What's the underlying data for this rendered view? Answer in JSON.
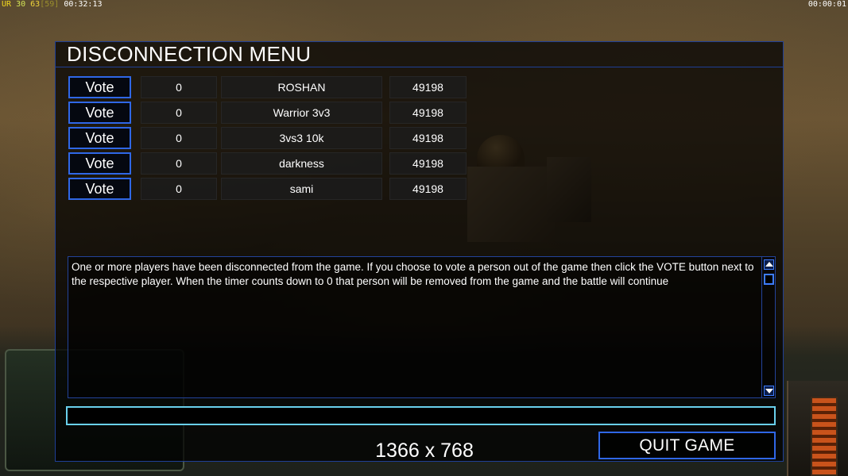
{
  "hud": {
    "stat_ur": "UR",
    "stat_a": "30",
    "stat_b": "63",
    "stat_c": "[59]",
    "game_clock": "00:32:13",
    "top_right_clock": "00:00:01"
  },
  "dialog": {
    "title": "DISCONNECTION MENU",
    "players": [
      {
        "vote_label": "Vote",
        "votes": "0",
        "name": "ROSHAN",
        "value": "49198"
      },
      {
        "vote_label": "Vote",
        "votes": "0",
        "name": "Warrior 3v3",
        "value": "49198"
      },
      {
        "vote_label": "Vote",
        "votes": "0",
        "name": "3vs3 10k",
        "value": "49198"
      },
      {
        "vote_label": "Vote",
        "votes": "0",
        "name": "darkness",
        "value": "49198"
      },
      {
        "vote_label": "Vote",
        "votes": "0",
        "name": "sami",
        "value": "49198"
      }
    ],
    "info_text": "One or more players have been disconnected from the game. If you choose to vote a person out of the game then click the VOTE  button next to the respective player. When the timer counts down to 0 that person will be removed from the game and the battle will  continue",
    "chat_value": "",
    "resolution_label": "1366 x 768",
    "quit_label": "QUIT GAME"
  },
  "colors": {
    "accent_blue": "#2f67e6",
    "input_cyan": "#69d0ec",
    "text": "#ffffff"
  }
}
